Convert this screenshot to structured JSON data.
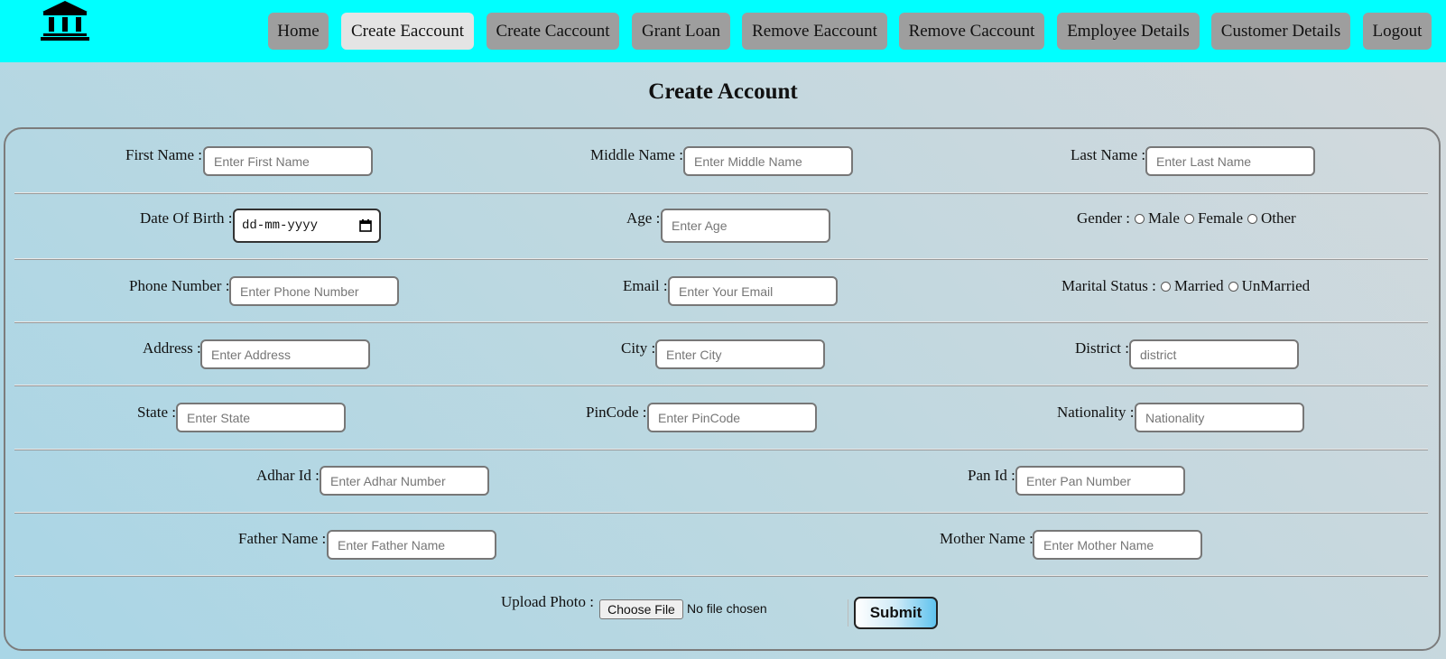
{
  "nav": {
    "items": [
      {
        "label": "Home"
      },
      {
        "label": "Create Eaccount"
      },
      {
        "label": "Create Caccount"
      },
      {
        "label": "Grant Loan"
      },
      {
        "label": "Remove Eaccount"
      },
      {
        "label": "Remove Caccount"
      },
      {
        "label": "Employee Details"
      },
      {
        "label": "Customer Details"
      },
      {
        "label": "Logout"
      }
    ],
    "active": "Create Eaccount",
    "logo_icon": "bank-icon"
  },
  "page": {
    "title": "Create Account"
  },
  "form": {
    "first_name": {
      "label": "First Name :",
      "placeholder": "Enter First Name"
    },
    "middle_name": {
      "label": "Middle Name :",
      "placeholder": "Enter Middle Name"
    },
    "last_name": {
      "label": "Last Name :",
      "placeholder": "Enter Last Name"
    },
    "dob": {
      "label": "Date Of Birth :",
      "placeholder": "dd-mm-yyyy"
    },
    "age": {
      "label": "Age :",
      "placeholder": "Enter Age"
    },
    "gender": {
      "label": "Gender :",
      "options": [
        "Male",
        "Female",
        "Other"
      ]
    },
    "phone": {
      "label": "Phone Number :",
      "placeholder": "Enter Phone Number"
    },
    "email": {
      "label": "Email :",
      "placeholder": "Enter Your Email"
    },
    "marital_status": {
      "label": "Marital Status :",
      "options": [
        "Married",
        "UnMarried"
      ]
    },
    "address": {
      "label": "Address :",
      "placeholder": "Enter Address"
    },
    "city": {
      "label": "City :",
      "placeholder": "Enter City"
    },
    "district": {
      "label": "District :",
      "placeholder": "district"
    },
    "state": {
      "label": "State :",
      "placeholder": "Enter State"
    },
    "pincode": {
      "label": "PinCode :",
      "placeholder": "Enter PinCode"
    },
    "nationality": {
      "label": "Nationality :",
      "placeholder": "Nationality"
    },
    "adhar": {
      "label": "Adhar Id :",
      "placeholder": "Enter Adhar Number"
    },
    "pan": {
      "label": "Pan Id :",
      "placeholder": "Enter Pan Number"
    },
    "father": {
      "label": "Father Name :",
      "placeholder": "Enter Father Name"
    },
    "mother": {
      "label": "Mother Name :",
      "placeholder": "Enter Mother Name"
    },
    "photo": {
      "label": "Upload Photo :",
      "button": "Choose File",
      "status": "No file chosen"
    },
    "submit": "Submit"
  },
  "colors": {
    "header": "#00ffff",
    "nav_button": "#9e9e9e",
    "nav_active": "#e4e4e4"
  }
}
